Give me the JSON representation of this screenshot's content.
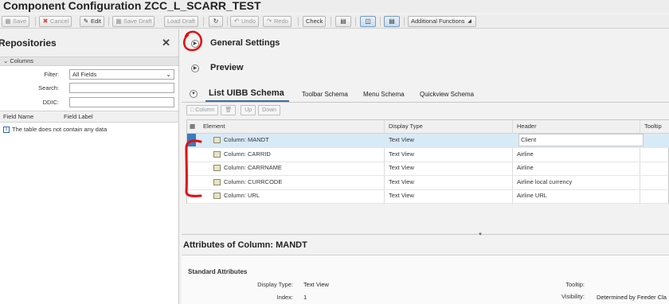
{
  "window": {
    "title": "Component Configuration ZCC_L_SCARR_TEST"
  },
  "toolbar": {
    "save": "Save",
    "cancel": "Cancel",
    "edit": "Edit",
    "save_draft": "Save Draft",
    "load_draft": "Load Draft",
    "undo": "Undo",
    "redo": "Redo",
    "check": "Check",
    "additional_functions": "Additional Functions"
  },
  "repositories": {
    "title": "Repositories",
    "group": "Columns",
    "filter_label": "Filter:",
    "filter_value": "All Fields",
    "search_label": "Search:",
    "search_value": "",
    "ddic_label": "DDIC:",
    "ddic_value": "",
    "table": {
      "columns": [
        "Field Name",
        "Field Label"
      ],
      "empty_message": "The table does not contain any data"
    }
  },
  "sections": {
    "general_settings": "General Settings",
    "preview": "Preview"
  },
  "tabs": [
    {
      "label": "List UIBB Schema",
      "active": true
    },
    {
      "label": "Toolbar Schema",
      "active": false
    },
    {
      "label": "Menu Schema",
      "active": false
    },
    {
      "label": "Quickview Schema",
      "active": false
    }
  ],
  "schema_toolbar": {
    "add_column": "Column",
    "up": "Up",
    "down": "Down"
  },
  "schema_grid": {
    "columns": [
      "Element",
      "Display Type",
      "Header",
      "Tooltip"
    ],
    "rows": [
      {
        "element": "Column: MANDT",
        "display_type": "Text View",
        "header": "Client",
        "tooltip": "",
        "selected": true
      },
      {
        "element": "Column: CARRID",
        "display_type": "Text View",
        "header": "Airline",
        "tooltip": ""
      },
      {
        "element": "Column: CARRNAME",
        "display_type": "Text View",
        "header": "Airline",
        "tooltip": ""
      },
      {
        "element": "Column: CURRCODE",
        "display_type": "Text View",
        "header": "Airline local currency",
        "tooltip": ""
      },
      {
        "element": "Column: URL",
        "display_type": "Text View",
        "header": "Airline URL",
        "tooltip": ""
      }
    ]
  },
  "attributes": {
    "title": "Attributes of Column: MANDT",
    "subtitle": "Standard Attributes",
    "display_type_label": "Display Type:",
    "display_type_value": "Text View",
    "index_label": "Index:",
    "index_value": "1",
    "tooltip_label": "Tooltip:",
    "tooltip_value": "",
    "visibility_label": "Visibility:",
    "visibility_value": "Determined by Feeder Cla"
  },
  "colors": {
    "selection": "#d9eaf7",
    "row_marker": "#3a7cc0",
    "annotation": "#e01010"
  }
}
